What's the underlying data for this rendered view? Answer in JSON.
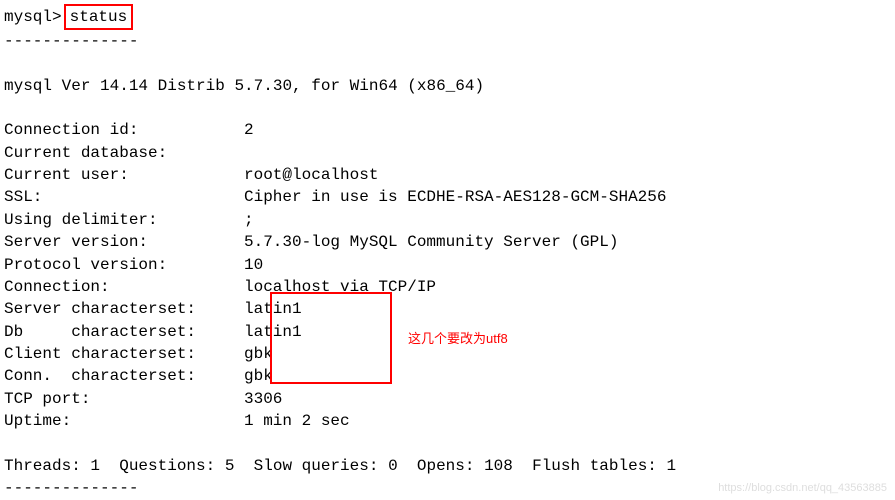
{
  "prompt": {
    "label": "mysql>",
    "command": "status"
  },
  "dashes_top": "--------------",
  "version_line": "mysql  Ver 14.14 Distrib 5.7.30, for Win64 (x86_64)",
  "rows": {
    "connection_id": {
      "label": "Connection id:",
      "value": "2"
    },
    "current_database": {
      "label": "Current database:",
      "value": ""
    },
    "current_user": {
      "label": "Current user:",
      "value": "root@localhost"
    },
    "ssl": {
      "label": "SSL:",
      "value": "Cipher in use is ECDHE-RSA-AES128-GCM-SHA256"
    },
    "using_delimiter": {
      "label": "Using delimiter:",
      "value": ";"
    },
    "server_version": {
      "label": "Server version:",
      "value": "5.7.30-log MySQL Community Server (GPL)"
    },
    "protocol_version": {
      "label": "Protocol version:",
      "value": "10"
    },
    "connection": {
      "label": "Connection:",
      "value": "localhost via TCP/IP"
    },
    "server_charset": {
      "label": "Server characterset:",
      "value": "latin1"
    },
    "db_charset": {
      "label": "Db     characterset:",
      "value": "latin1"
    },
    "client_charset": {
      "label": "Client characterset:",
      "value": "gbk"
    },
    "conn_charset": {
      "label": "Conn.  characterset:",
      "value": "gbk"
    },
    "tcp_port": {
      "label": "TCP port:",
      "value": "3306"
    },
    "uptime": {
      "label": "Uptime:",
      "value": "1 min 2 sec"
    }
  },
  "stats_line": "Threads: 1  Questions: 5  Slow queries: 0  Opens: 108  Flush tables: 1",
  "dashes_bottom": "--------------",
  "annotation": "这几个要改为utf8",
  "watermark": "https://blog.csdn.net/qq_43563885"
}
